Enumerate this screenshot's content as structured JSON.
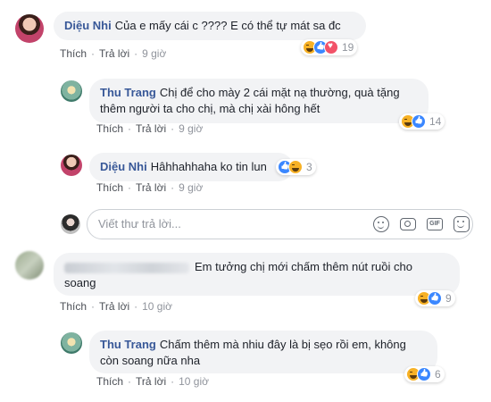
{
  "labels": {
    "like": "Thích",
    "reply": "Trả lời",
    "dot": "·"
  },
  "reply_box": {
    "placeholder": "Viết thư trả lời..."
  },
  "colors": {
    "author": "#385898",
    "bubble": "#f2f3f5",
    "haha": "#f7b125",
    "like": "#3b87ff",
    "love": "#f25268"
  },
  "comments": [
    {
      "author": "Diệu Nhi",
      "text": "Của e mấy cái c ???? E có thể tự mát sa đc",
      "time": "9 giờ",
      "reactions": [
        "haha",
        "like",
        "love"
      ],
      "reaction_count": "19"
    },
    {
      "author": "Thu Trang",
      "text_line1": "Chị để cho mày 2 cái mặt nạ thường, quà tặng",
      "text_line2": "thêm người ta cho chị, mà chị xài hông hết",
      "time": "9 giờ",
      "reactions": [
        "haha",
        "like"
      ],
      "reaction_count": "14"
    },
    {
      "author": "Diệu Nhi",
      "text": "Hâhhahhaha ko tin lun",
      "time": "9 giờ",
      "reactions": [
        "like",
        "haha"
      ],
      "reaction_count": "3"
    },
    {
      "author": "",
      "text_line1": "Em tưởng chị mới chấm thêm nút ruồi cho",
      "text_line2": "soang",
      "time": "10 giờ",
      "reactions": [
        "haha",
        "like"
      ],
      "reaction_count": "9"
    },
    {
      "author": "Thu Trang",
      "text_line1": "Chấm thêm mà nhiu đây là bị sẹo rồi em, không",
      "text_line2": "còn soang nữa nha",
      "time": "10 giờ",
      "reactions": [
        "haha",
        "like"
      ],
      "reaction_count": "6"
    }
  ],
  "icons": [
    "emoji-icon",
    "camera-icon",
    "gif-icon",
    "sticker-icon"
  ],
  "gif_text": "GIF"
}
